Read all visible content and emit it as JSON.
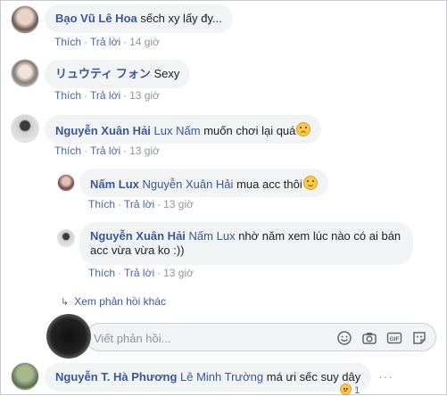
{
  "comments": [
    {
      "author": "Bạo Vũ Lê Hoa",
      "tag": "",
      "text": "sếch xy lấy đy...",
      "like": "Thích",
      "reply": "Trả lời",
      "time": "14 giờ"
    },
    {
      "author": "リュウティ フォン",
      "tag": "",
      "text": "Sexy",
      "like": "Thích",
      "reply": "Trả lời",
      "time": "13 giờ"
    },
    {
      "author": "Nguyễn Xuân Hải",
      "tag": "Lux Nấm",
      "text": "muốn chơi lại quá",
      "emoji": "sad-face-icon",
      "like": "Thích",
      "reply": "Trả lời",
      "time": "13 giờ"
    },
    {
      "author": "Nấm Lux",
      "tag": "Nguyễn Xuân Hải",
      "text": "mua acc thôi",
      "emoji": "smirk-face-icon",
      "like": "Thích",
      "reply": "Trả lời",
      "time": "13 giờ"
    },
    {
      "author": "Nguyễn Xuân Hải",
      "tag": "Nấm Lux",
      "text": "nhờ năm xem lúc nào có ai bán acc vừa vừa ko :))",
      "like": "Thích",
      "reply": "Trả lời",
      "time": "13 giờ"
    },
    {
      "author": "Nguyễn T. Hà Phương",
      "tag": "Lê Minh Trường",
      "text": "má ưi sếc suy dây",
      "react_count": "1"
    }
  ],
  "more_replies": "Xem phản hồi khác",
  "reply_box": {
    "placeholder": "Viết phản hồi...",
    "icons": [
      "emoji-icon",
      "camera-icon",
      "gif-icon",
      "sticker-icon"
    ]
  },
  "colors": {
    "link": "#385898",
    "action": "#4267b2",
    "muted": "#90949c",
    "bubble": "#f2f3f5"
  }
}
